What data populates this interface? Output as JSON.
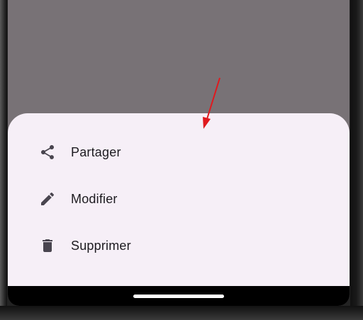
{
  "bottom_sheet": {
    "items": [
      {
        "label": "Partager",
        "icon": "share-icon"
      },
      {
        "label": "Modifier",
        "icon": "edit-icon"
      },
      {
        "label": "Supprimer",
        "icon": "delete-icon"
      }
    ]
  },
  "colors": {
    "scrim": "#787276",
    "sheet_background": "#f6eff7",
    "icon": "#49454f",
    "label": "#1d1b20",
    "annotation_arrow": "#e0191e"
  },
  "annotation": {
    "icon": "arrow-annotation"
  }
}
